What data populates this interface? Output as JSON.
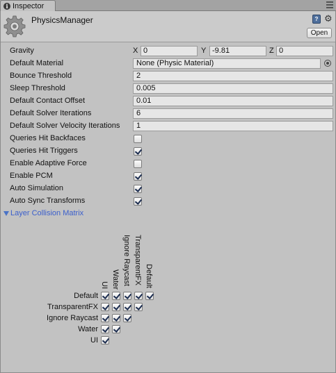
{
  "tab": {
    "label": "Inspector"
  },
  "header": {
    "title": "PhysicsManager",
    "open_label": "Open"
  },
  "gravity": {
    "label": "Gravity",
    "x_label": "X",
    "x": "0",
    "y_label": "Y",
    "y": "-9.81",
    "z_label": "Z",
    "z": "0"
  },
  "default_material": {
    "label": "Default Material",
    "value": "None (Physic Material)"
  },
  "fields": [
    {
      "label": "Bounce Threshold",
      "value": "2"
    },
    {
      "label": "Sleep Threshold",
      "value": "0.005"
    },
    {
      "label": "Default Contact Offset",
      "value": "0.01"
    },
    {
      "label": "Default Solver Iterations",
      "value": "6"
    },
    {
      "label": "Default Solver Velocity Iterations",
      "value": "1"
    }
  ],
  "toggles": [
    {
      "label": "Queries Hit Backfaces",
      "checked": false
    },
    {
      "label": "Queries Hit Triggers",
      "checked": true
    },
    {
      "label": "Enable Adaptive Force",
      "checked": false
    },
    {
      "label": "Enable PCM",
      "checked": true
    },
    {
      "label": "Auto Simulation",
      "checked": true
    },
    {
      "label": "Auto Sync Transforms",
      "checked": true
    }
  ],
  "layer_matrix": {
    "label": "Layer Collision Matrix",
    "columns": [
      "UI",
      "Water",
      "Ignore Raycast",
      "TransparentFX",
      "Default"
    ],
    "rows": [
      "Default",
      "TransparentFX",
      "Ignore Raycast",
      "Water",
      "UI"
    ]
  },
  "icons": {
    "tab": "info-icon",
    "header": "gear-icon",
    "help": "help-book-icon",
    "settings": "settings-gear-icon",
    "picker": "object-picker-icon",
    "fold": "foldout-arrow-icon"
  }
}
